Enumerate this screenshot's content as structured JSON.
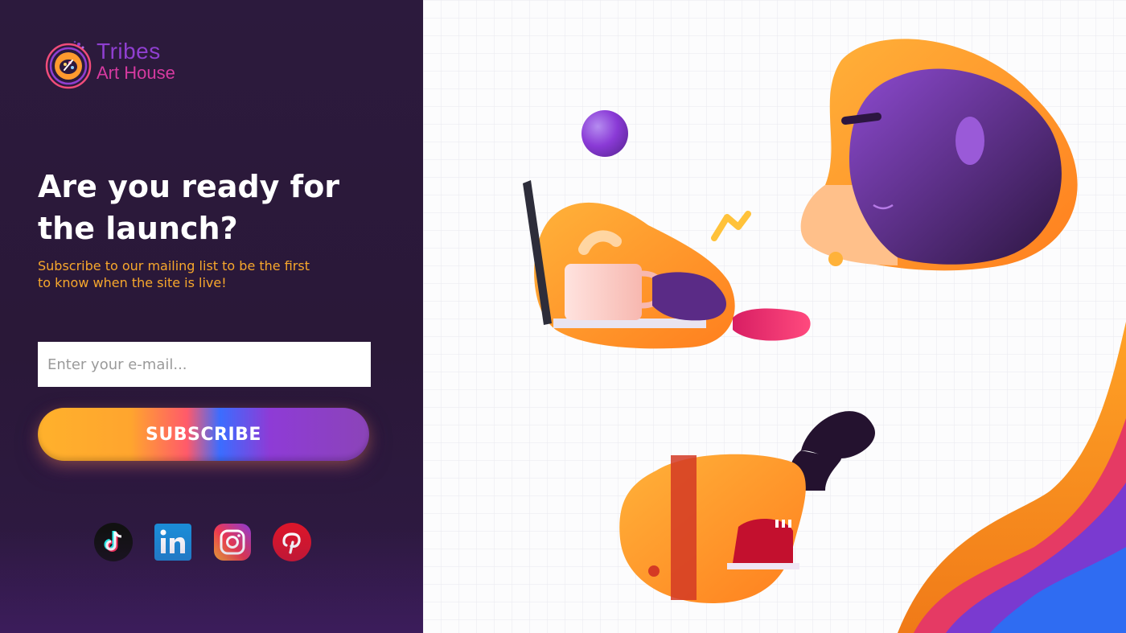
{
  "brand": {
    "name_line1": "Tribes",
    "name_line2": "Art House"
  },
  "hero": {
    "headline": "Are you ready for the launch?",
    "subtext": "Subscribe to our mailing list to be the first to know when the site is live!"
  },
  "form": {
    "email_placeholder": "Enter your e-mail...",
    "email_value": "",
    "subscribe_label": "SUBSCRIBE"
  },
  "social": [
    {
      "name": "tiktok-icon"
    },
    {
      "name": "linkedin-icon"
    },
    {
      "name": "instagram-icon"
    },
    {
      "name": "pinterest-icon"
    }
  ],
  "colors": {
    "panel_bg": "#2c1a3d",
    "accent_orange": "#f7a72c",
    "accent_purple": "#8f3fd0",
    "accent_pink": "#d63aa0"
  }
}
